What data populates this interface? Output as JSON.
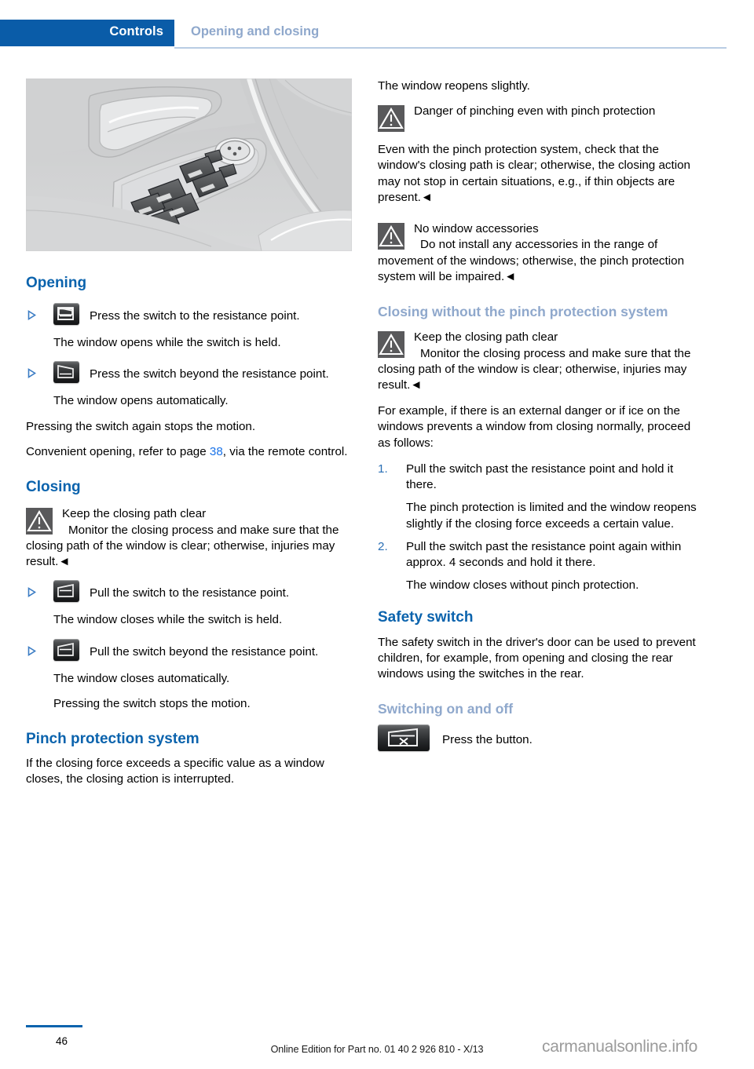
{
  "header": {
    "chapter": "Controls",
    "section": "Opening and closing",
    "chapter_tab_color": "#0a5ca8",
    "section_color": "#8fa8cc"
  },
  "figure": {
    "alt_name": "driver-door-panel-window-switches-illustration"
  },
  "left_column": {
    "opening": {
      "heading": "Opening",
      "steps": [
        {
          "icon": "window-open-switch-icon",
          "instruction": "Press the switch to the resistance point.",
          "result": "The window opens while the switch is held."
        },
        {
          "icon": "window-open-auto-switch-icon",
          "instruction": "Press the switch beyond the resistance point.",
          "result": "The window opens automatically."
        }
      ],
      "note": "Pressing the switch again stops the motion.",
      "xref_prefix": "Convenient opening, refer to page ",
      "xref_page": "38",
      "xref_suffix": ", via the remote control."
    },
    "closing": {
      "heading": "Closing",
      "warning": {
        "icon": "warning-triangle-icon",
        "title": "Keep the closing path clear",
        "body": "Monitor the closing process and make sure that the closing path of the window is clear; otherwise, injuries may result.",
        "endmark": "◄"
      },
      "steps": [
        {
          "icon": "window-close-switch-icon",
          "instruction": "Pull the switch to the resistance point.",
          "result": "The window closes while the switch is held."
        },
        {
          "icon": "window-close-auto-switch-icon",
          "instruction": "Pull the switch beyond the resistance point.",
          "result": "The window closes automatically."
        }
      ],
      "note": "Pressing the switch stops the motion."
    },
    "pinch_protection": {
      "heading": "Pinch protection system",
      "body": "If the closing force exceeds a specific value as a window closes, the closing action is interrupted."
    }
  },
  "right_column": {
    "continued_text": "The window reopens slightly.",
    "warning_pinch_danger": {
      "icon": "warning-triangle-icon",
      "title": "Danger of pinching even with pinch protection",
      "body": "Even with the pinch protection system, check that the window's closing path is clear; otherwise, the closing action may not stop in certain situations, e.g., if thin objects are present.",
      "endmark": "◄"
    },
    "warning_no_accessories": {
      "icon": "warning-triangle-icon",
      "title": "No window accessories",
      "body": "Do not install any accessories in the range of movement of the windows; otherwise, the pinch protection system will be impaired.",
      "endmark": "◄"
    },
    "closing_without_pinch": {
      "heading": "Closing without the pinch protection system",
      "warning": {
        "icon": "warning-triangle-icon",
        "title": "Keep the closing path clear",
        "body": "Monitor the closing process and make sure that the closing path of the window is clear; otherwise, injuries may result.",
        "endmark": "◄"
      },
      "intro": "For example, if there is an external danger or if ice on the windows prevents a window from closing normally, proceed as follows:",
      "items": [
        {
          "num": "1.",
          "text": "Pull the switch past the resistance point and hold it there.",
          "sub": "The pinch protection is limited and the window reopens slightly if the closing force exceeds a certain value."
        },
        {
          "num": "2.",
          "text": "Pull the switch past the resistance point again within approx. 4 seconds and hold it there.",
          "sub": "The window closes without pinch protection."
        }
      ]
    },
    "safety_switch": {
      "heading": "Safety switch",
      "body": "The safety switch in the driver's door can be used to prevent children, for example, from opening and closing the rear windows using the switches in the rear.",
      "subheading": "Switching on and off",
      "action_icon": "rear-window-lockout-button-icon",
      "action_text": "Press the button."
    }
  },
  "footer": {
    "page_number": "46",
    "edition": "Online Edition for Part no. 01 40 2 926 810 - X/13",
    "watermark": "carmanualsonline.info",
    "rule_color": "#0b63ad"
  }
}
